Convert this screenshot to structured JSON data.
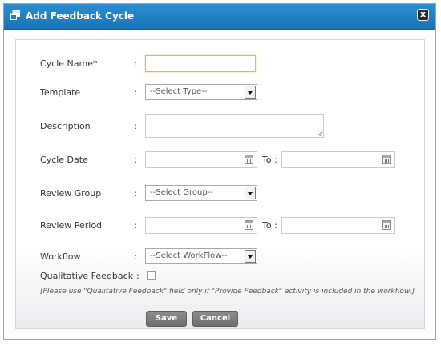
{
  "dialog": {
    "title": "Add Feedback Cycle",
    "close_label": "x"
  },
  "form": {
    "cycle_name": {
      "label": "Cycle Name*",
      "colon": ":",
      "value": ""
    },
    "template": {
      "label": "Template",
      "colon": ":",
      "selected": "--Select Type--"
    },
    "description": {
      "label": "Description",
      "colon": ":",
      "value": ""
    },
    "cycle_date": {
      "label": "Cycle Date",
      "colon": ":",
      "to_label": "To :",
      "from_value": "",
      "to_value": ""
    },
    "review_group": {
      "label": "Review Group",
      "colon": ":",
      "selected": "--Select Group--"
    },
    "review_period": {
      "label": "Review Period",
      "colon": ":",
      "to_label": "To :",
      "from_value": "",
      "to_value": ""
    },
    "workflow": {
      "label": "Workflow",
      "colon": ":",
      "selected": "--Select WorkFlow--"
    },
    "qualitative_feedback": {
      "label": "Qualitative Feedback",
      "colon": ":",
      "checked": false
    },
    "note": "[Please use \"Qualitative Feedback\" field only if \"Provide Feedback\" activity is included in the workflow.]"
  },
  "buttons": {
    "save_label": "Save",
    "cancel_label": "Cancel"
  },
  "colors": {
    "title_bar": "#1f80c3",
    "button": "#7d7d7d",
    "focus_border": "#e3b84a"
  },
  "icons": {
    "title": "dialog-window-icon",
    "close": "close-icon",
    "date": "calendar-icon",
    "select": "dropdown-arrow-icon"
  }
}
